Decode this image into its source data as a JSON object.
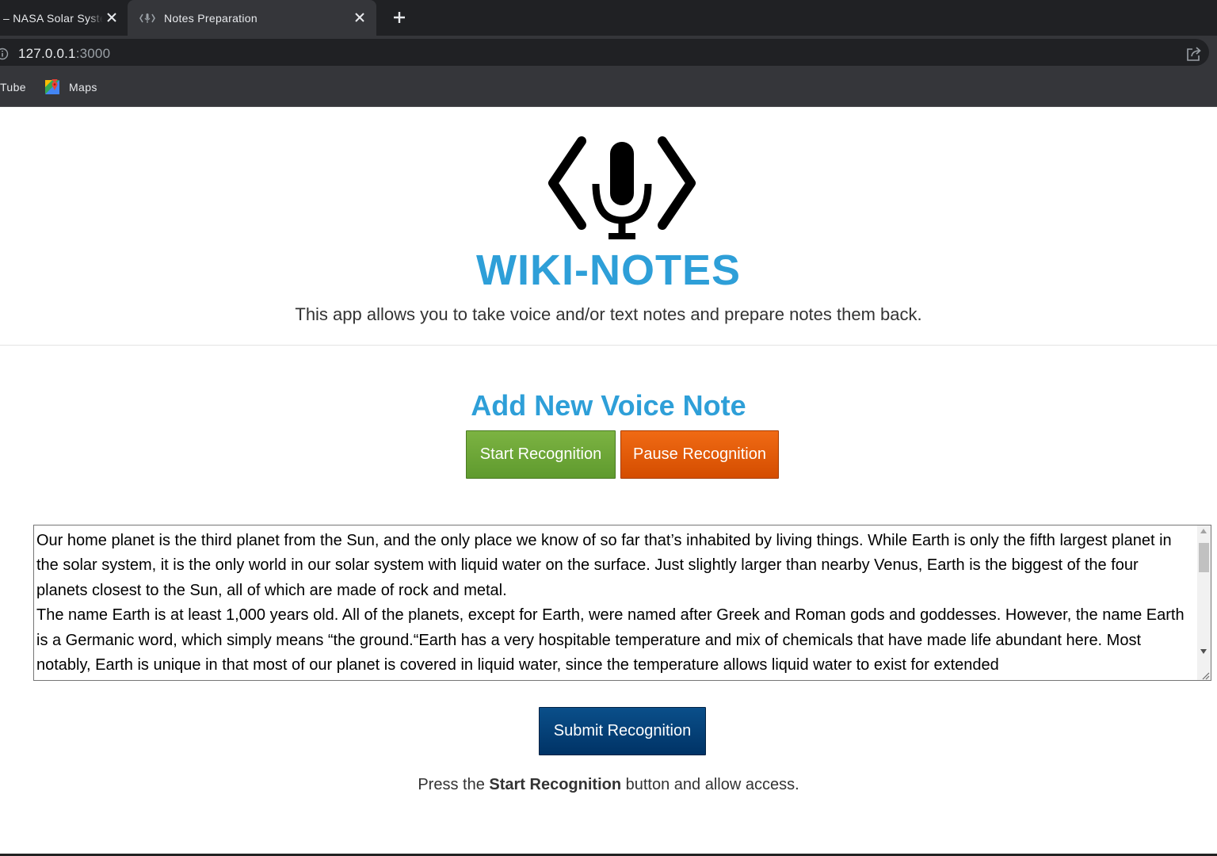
{
  "browser": {
    "tabs": [
      {
        "title": "– NASA Solar System",
        "active": false
      },
      {
        "title": "Notes Preparation",
        "active": true
      }
    ],
    "url": {
      "host": "127.0.0.1",
      "port": ":3000"
    },
    "bookmarks": [
      {
        "label": "Tube"
      },
      {
        "label": "Maps"
      }
    ],
    "icons": [
      "close-icon",
      "new-tab-icon",
      "info-icon",
      "share-icon",
      "maps-icon"
    ]
  },
  "page": {
    "title": "WIKI-NOTES",
    "description": "This app allows you to take voice and/or text notes and prepare notes them back.",
    "section_title": "Add New Voice Note",
    "buttons": {
      "start": "Start Recognition",
      "pause": "Pause Recognition",
      "submit": "Submit Recognition"
    },
    "note_text": "Our home planet is the third planet from the Sun, and the only place we know of so far that’s inhabited by living things. While Earth is only the fifth largest planet in the solar system, it is the only world in our solar system with liquid water on the surface. Just slightly larger than nearby Venus, Earth is the biggest of the four planets closest to the Sun, all of which are made of rock and metal.\nThe name Earth is at least 1,000 years old. All of the planets, except for Earth, were named after Greek and Roman gods and goddesses. However, the name Earth is a Germanic word, which simply means “the ground.“Earth has a very hospitable temperature and mix of chemicals that have made life abundant here. Most notably, Earth is unique in that most of our planet is covered in liquid water, since the temperature allows liquid water to exist for extended",
    "hint": {
      "before": "Press the ",
      "bold": "Start Recognition",
      "after": " button and allow access."
    },
    "colors": {
      "title": "#2e9fd8",
      "start_button": "#6aa637",
      "pause_button": "#e35c0a",
      "submit_button": "#003f78"
    }
  }
}
